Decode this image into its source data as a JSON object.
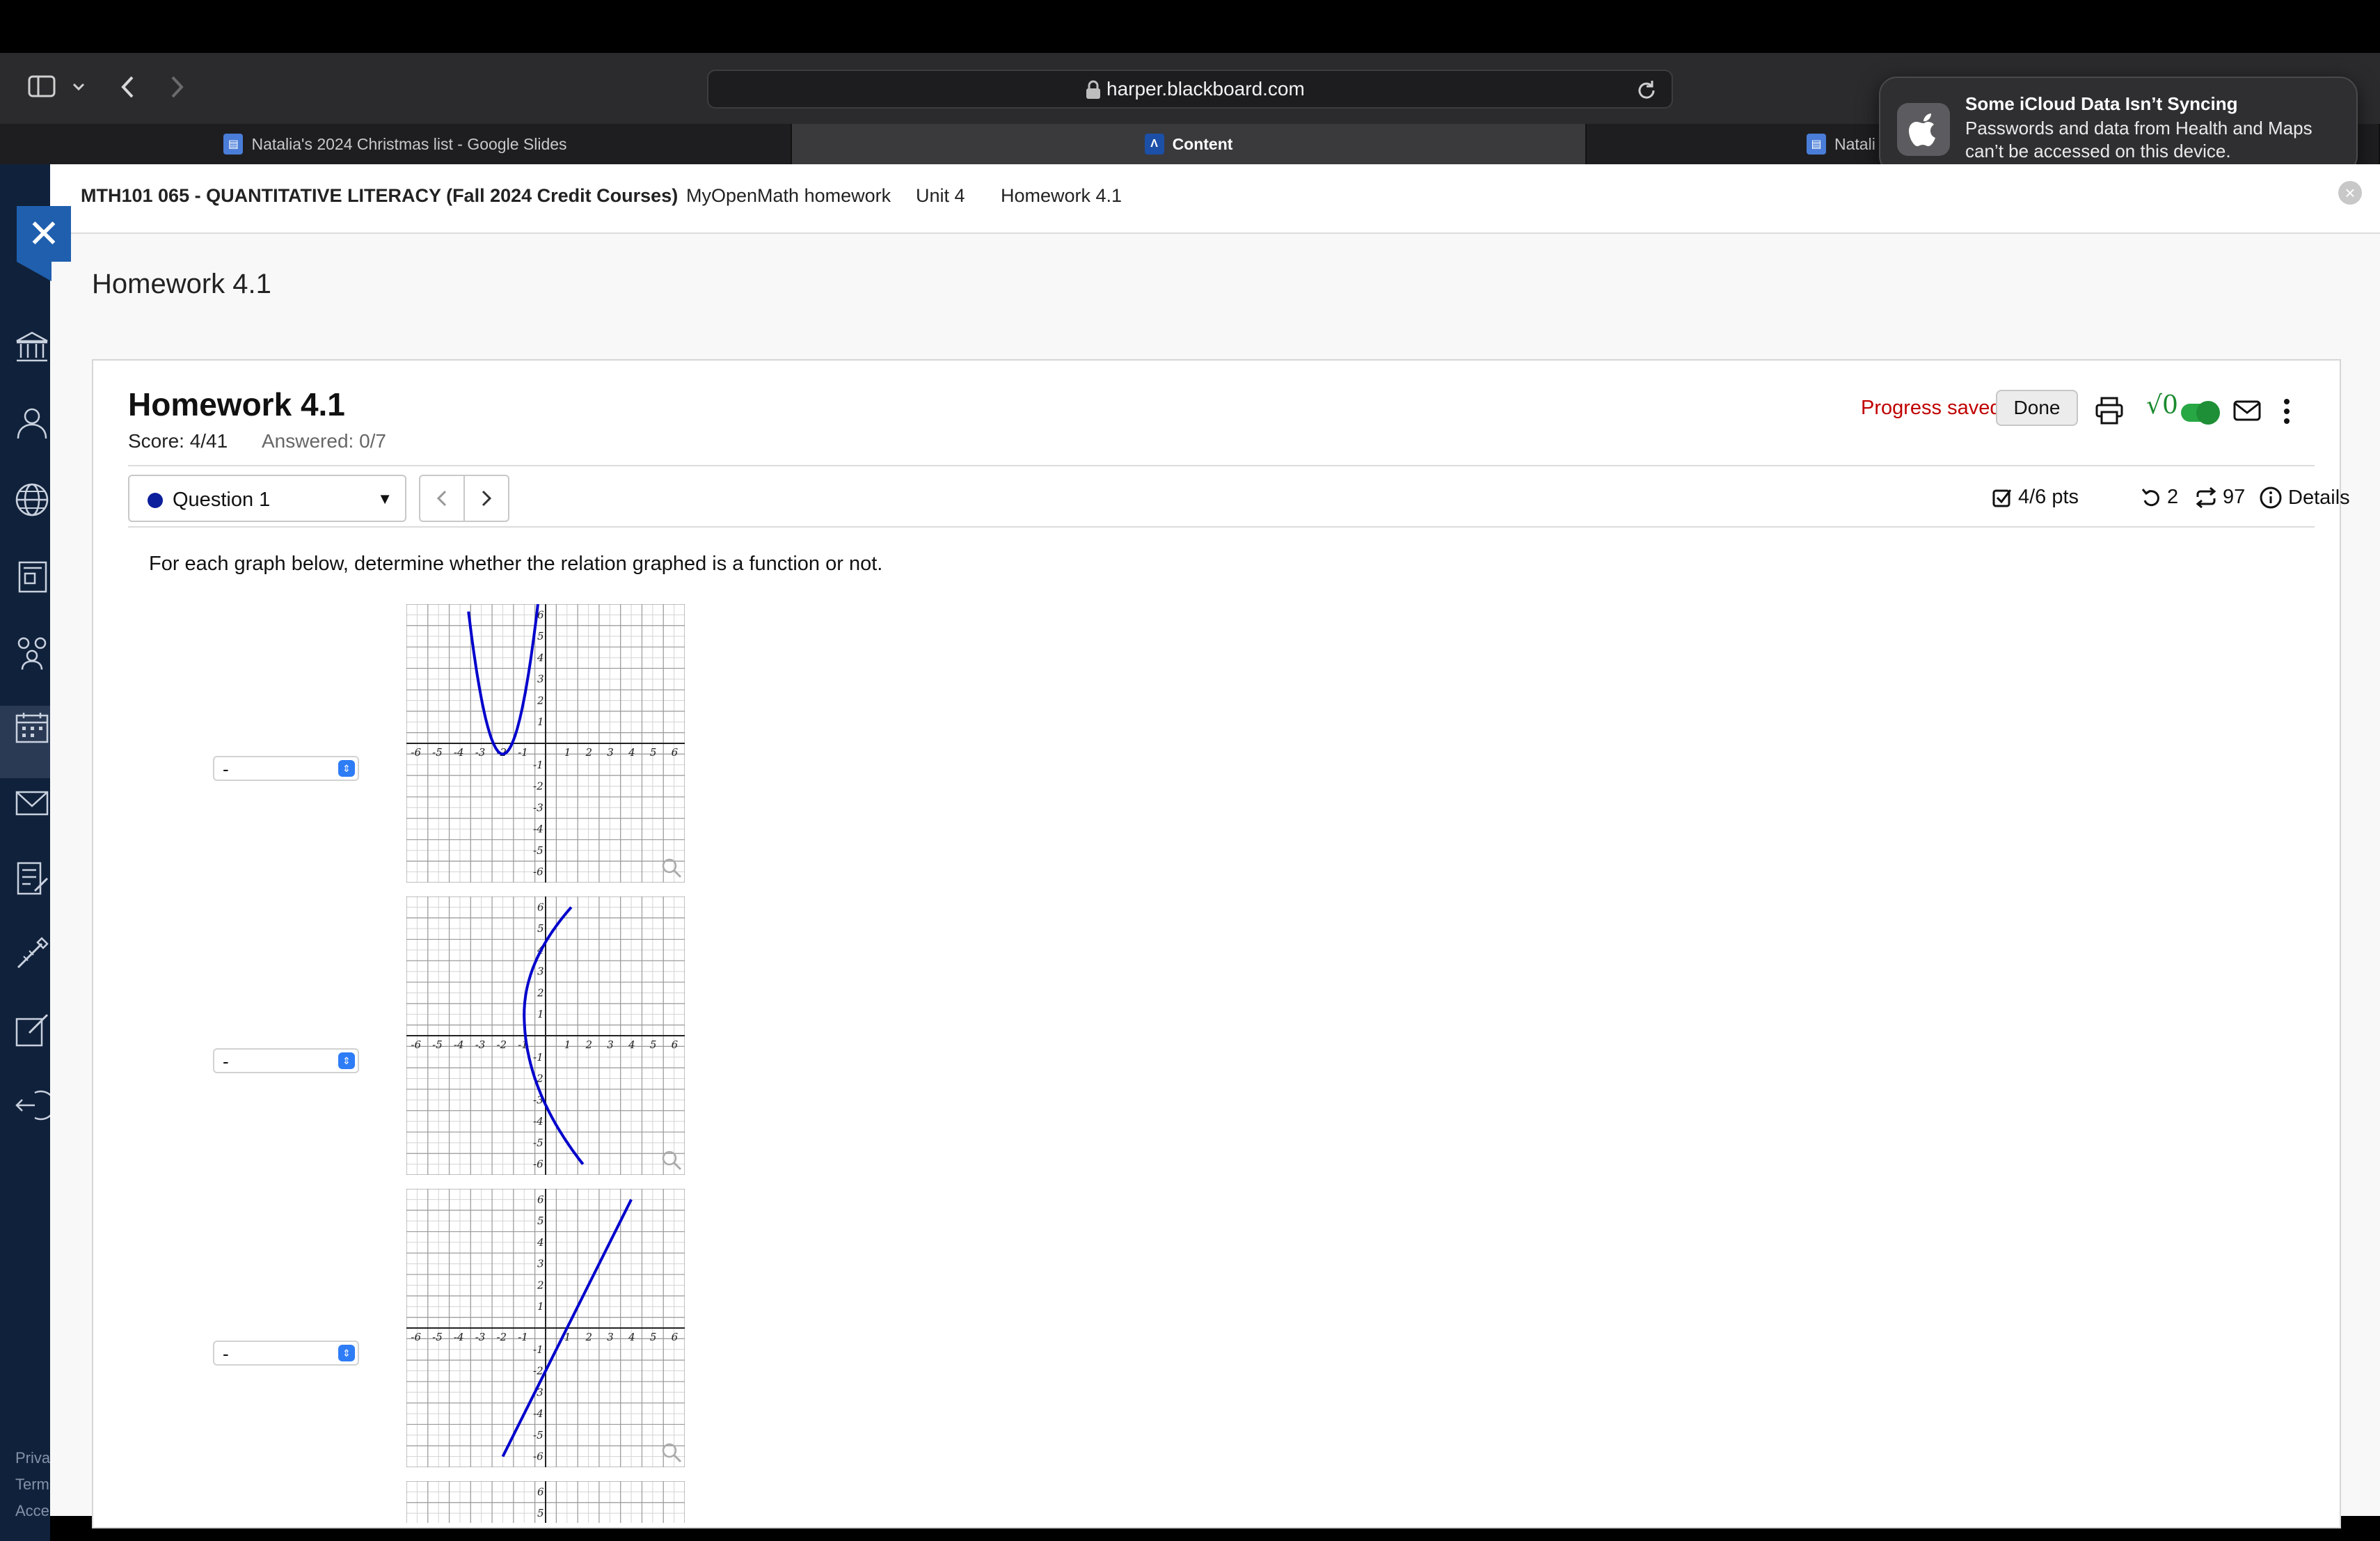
{
  "browser": {
    "url": "harper.blackboard.com",
    "tabs": [
      {
        "label": "Natalia's 2024 Christmas list - Google Slides"
      },
      {
        "label": "Content"
      },
      {
        "label": "Natali"
      }
    ]
  },
  "notification": {
    "title": "Some iCloud Data Isn’t Syncing",
    "body": "Passwords and data from Health and Maps can’t be accessed on this device."
  },
  "breadcrumb": {
    "course": "MTH101 065 - QUANTITATIVE LITERACY (Fall 2024 Credit Courses)",
    "items": [
      "MyOpenMath homework",
      "Unit 4",
      "Homework 4.1"
    ]
  },
  "page": {
    "title": "Homework 4.1"
  },
  "homework": {
    "title": "Homework 4.1",
    "score": "Score: 4/41",
    "answered": "Answered: 0/7",
    "progress": "Progress saved",
    "done": "Done",
    "sqrt_label": "√0"
  },
  "question": {
    "selector": "Question 1",
    "points": "4/6 pts",
    "retries": "2",
    "attempts": "97",
    "details": "Details",
    "prompt": "For each graph below, determine whether the relation graphed is a function or not."
  },
  "answers": [
    {
      "value": "-"
    },
    {
      "value": "-"
    },
    {
      "value": "-"
    }
  ],
  "graphs": {
    "xticks": [
      "-6",
      "-5",
      "-4",
      "-3",
      "-2",
      "-1",
      "1",
      "2",
      "3",
      "4",
      "5",
      "6"
    ],
    "yticks": [
      "6",
      "5",
      "4",
      "3",
      "2",
      "1",
      "-1",
      "-2",
      "-3",
      "-4",
      "-5",
      "-6"
    ],
    "curve_color": "#0000cc"
  },
  "leftnav_footer": [
    "Priva",
    "Term",
    "Acce"
  ],
  "colors": {
    "accent": "#1f5fae",
    "nav_bg": "#10213b",
    "error": "#c00000",
    "toggle": "#28a745"
  }
}
